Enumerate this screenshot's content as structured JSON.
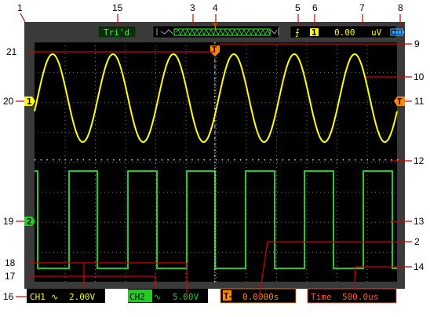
{
  "status_bar": {
    "trigger_state": "Tri'd",
    "trigger_slope_symbol": "⨍",
    "trigger_source": "1",
    "trigger_level": "0.00",
    "trigger_level_unit": "uV",
    "battery_icon": "battery-icon",
    "waveform_position_icon": "memory-window-icon",
    "trigger_position_marker": "T"
  },
  "channel_markers": {
    "ch1": "1",
    "ch2": "2",
    "trigger_level_marker": "T",
    "trigger_time_marker": "T"
  },
  "bottom_bar": {
    "ch1_label": "CH1",
    "ch1_coupling_symbol": "∿",
    "ch1_scale": "2.00V",
    "ch2_label": "CH2",
    "ch2_coupling_symbol": "∿",
    "ch2_scale": "5.00V",
    "horizontal_position_icon": "T→",
    "horizontal_position": "0.0000s",
    "timebase_label": "Time",
    "timebase_value": "500.0us"
  },
  "callouts": [
    "1",
    "2",
    "3",
    "4",
    "5",
    "6",
    "7",
    "8",
    "9",
    "10",
    "11",
    "12",
    "13",
    "14",
    "15",
    "16",
    "17",
    "18",
    "19",
    "20",
    "21"
  ],
  "colors": {
    "ch1_trace": "#ffff00",
    "ch2_trace": "#22cc22",
    "accent_orange": "#ff8800",
    "screen_bg": "#000000",
    "bezel": "#3a3a3a",
    "status_green_text": "#33ff33",
    "timebase_red_text": "#ff5533"
  }
}
